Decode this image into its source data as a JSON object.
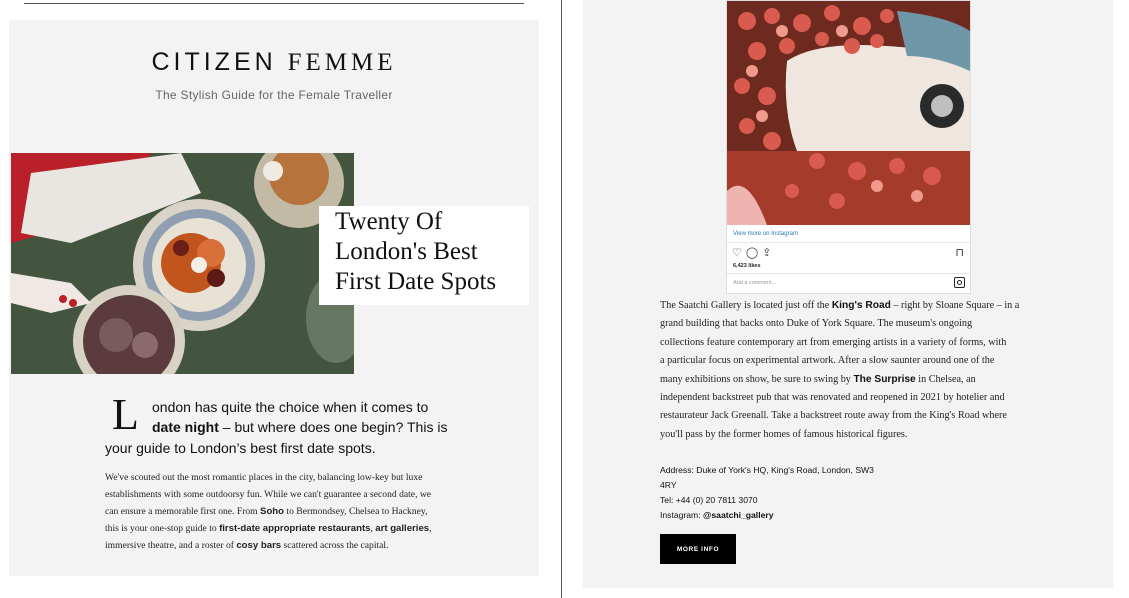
{
  "left": {
    "brand": {
      "part1": "CITIZEN ",
      "part2": "FEMME"
    },
    "tagline": "The Stylish Guide for the Female Traveller",
    "headline": [
      "Twenty Of",
      "London's Best",
      "First Date Spots"
    ],
    "intro": {
      "dropcap": "L",
      "line1": "ondon has quite the choice when it comes to",
      "line2_bold": "date night",
      "line2_rest": " – but where does one begin? This is",
      "line3": "your guide to London’s best first date spots."
    },
    "body": {
      "line1": "We've scouted out the most romantic places in the city, balancing low-key but luxe",
      "line2": "establishments with some outdoorsy fun. While we can't guarantee a second date, we",
      "line3_a": "can ensure a memorable first one. From ",
      "link_soho": "Soho",
      "line3_b": " to Bermondsey, Chelsea to Hackney,",
      "line4_a": "this is your one-stop guide to ",
      "link_restaurants": "first-date appropriate restaurants",
      "line4_b": ", ",
      "link_galleries": "art galleries",
      "line4_c": ",",
      "line5_a": "immersive theatre, and a roster of ",
      "link_bars": "cosy bars",
      "line5_b": " scattered across the capital."
    }
  },
  "right": {
    "instagram": {
      "view_more": "View more on Instagram",
      "likes": "6,423 likes",
      "comment_placeholder": "Add a comment..."
    },
    "paragraph": {
      "l1_a": "The Saatchi Gallery is located just off the ",
      "l1_link": "King's Road",
      "l1_b": " – right by Sloane Square – in a",
      "l2": "grand building that backs onto Duke of York Square. The museum's ongoing",
      "l3": "collections feature contemporary art from emerging artists in a variety of forms, with",
      "l4": "a particular focus on experimental artwork. After a slow saunter around one of the",
      "l5_a": "many exhibitions on show, be sure to swing by ",
      "l5_link": "The Surprise",
      "l5_b": " in Chelsea, an",
      "l6": "independent backstreet pub that was renovated and reopened in 2021 by hotelier and",
      "l7": "restaurateur Jack Greenall. Take a backstreet route away from the King's Road where",
      "l8": "you'll pass by the former homes of famous historical figures."
    },
    "address": {
      "line1": "Address: Duke of York's HQ, King's Road, London, SW3",
      "line2": "4RY",
      "tel": "Tel: +44 (0) 20 7811 3070",
      "insta_label": "Instagram: ",
      "insta_handle": "@saatchi_gallery"
    },
    "more_info": "MORE INFO"
  }
}
